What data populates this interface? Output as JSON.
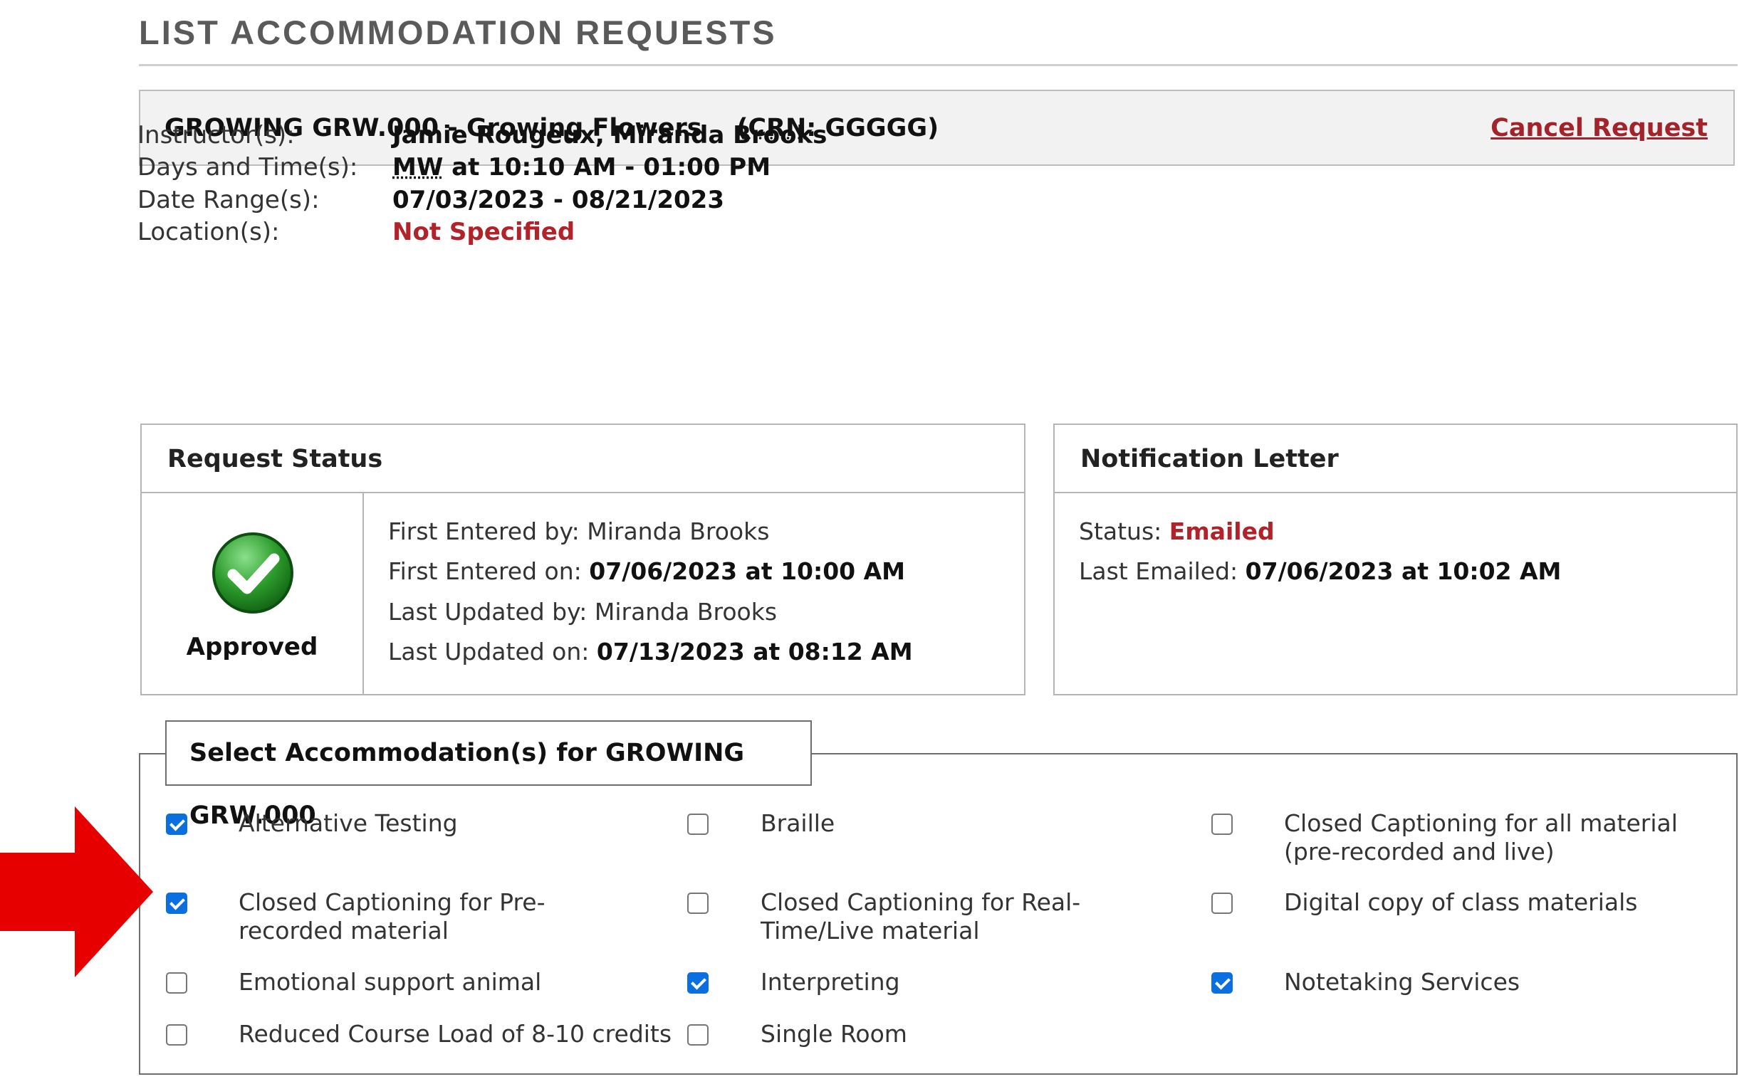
{
  "page": {
    "title": "LIST ACCOMMODATION REQUESTS"
  },
  "course": {
    "name": "GROWING GRW.000 - Growing Flowers",
    "crn_label": "CRN",
    "crn_value": "GGGGG",
    "cancel_label": "Cancel Request"
  },
  "info": {
    "instructors_label": "Instructor(s):",
    "instructors_value": "Jamie Rougeux, Miranda Brooks",
    "days_label": "Days and Time(s):",
    "days_abbr": "MW",
    "days_rest": " at 10:10 AM - 01:00 PM",
    "dates_label": "Date Range(s):",
    "dates_value": "07/03/2023 - 08/21/2023",
    "location_label": "Location(s):",
    "location_value": "Not Specified"
  },
  "request_status": {
    "heading": "Request Status",
    "status": "Approved",
    "first_entered_by_label": "First Entered by:",
    "first_entered_by": "Miranda Brooks",
    "first_entered_on_label": "First Entered on:",
    "first_entered_on": "07/06/2023 at 10:00 AM",
    "last_updated_by_label": "Last Updated by:",
    "last_updated_by": "Miranda Brooks",
    "last_updated_on_label": "Last Updated on:",
    "last_updated_on": "07/13/2023 at 08:12 AM"
  },
  "notification": {
    "heading": "Notification Letter",
    "status_label": "Status:",
    "status": "Emailed",
    "last_emailed_label": "Last Emailed:",
    "last_emailed": "07/06/2023 at 10:02 AM"
  },
  "accommodations": {
    "legend": "Select Accommodation(s) for GROWING GRW.000",
    "items": [
      {
        "label": "Alternative Testing",
        "checked": true
      },
      {
        "label": "Braille",
        "checked": false
      },
      {
        "label": "Closed Captioning for all material (pre-recorded and live)",
        "checked": false
      },
      {
        "label": "Closed Captioning for Pre-recorded material",
        "checked": true
      },
      {
        "label": "Closed Captioning for Real-Time/Live material",
        "checked": false
      },
      {
        "label": "Digital copy of class materials",
        "checked": false
      },
      {
        "label": "Emotional support animal",
        "checked": false
      },
      {
        "label": "Interpreting",
        "checked": true
      },
      {
        "label": "Notetaking Services",
        "checked": true
      },
      {
        "label": "Reduced Course Load of 8-10 credits",
        "checked": false
      },
      {
        "label": "Single Room",
        "checked": false
      }
    ]
  },
  "colors": {
    "accent_red": "#b0232a",
    "checkbox_blue": "#0b6fe0",
    "arrow_red": "#e60000",
    "approved_green": "#2c9b2c"
  }
}
